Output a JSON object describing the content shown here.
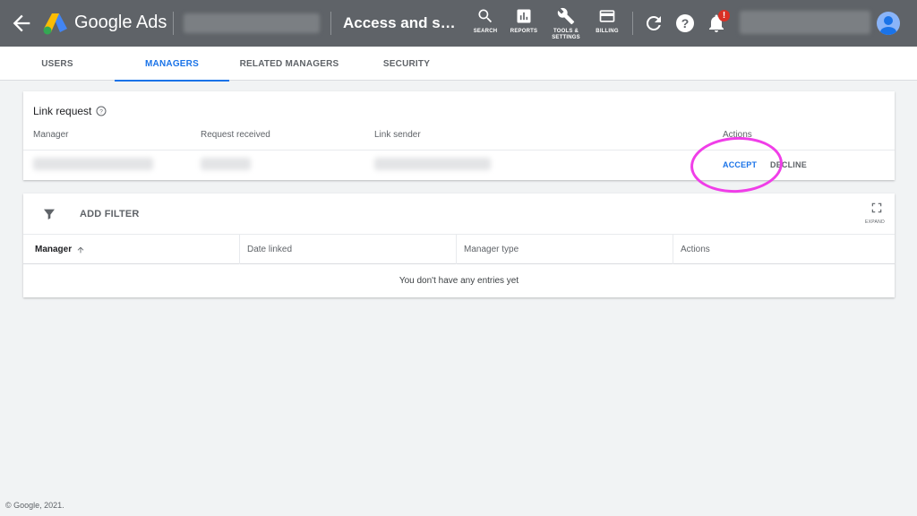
{
  "header": {
    "brand": "Google Ads",
    "page_title": "Access and s…",
    "toolbar": [
      {
        "label": "SEARCH",
        "icon": "search-icon"
      },
      {
        "label": "REPORTS",
        "icon": "reports-icon"
      },
      {
        "label": "TOOLS & SETTINGS",
        "icon": "wrench-icon"
      },
      {
        "label": "BILLING",
        "icon": "credit-card-icon"
      }
    ],
    "notification_badge": "!",
    "colors": {
      "bar": "#5f6368",
      "badge": "#d93025"
    }
  },
  "tabs": [
    {
      "label": "USERS",
      "active": false
    },
    {
      "label": "MANAGERS",
      "active": true
    },
    {
      "label": "RELATED MANAGERS",
      "active": false
    },
    {
      "label": "SECURITY",
      "active": false
    }
  ],
  "link_request": {
    "title": "Link request",
    "columns": [
      "Manager",
      "Request received",
      "Link sender",
      "Actions"
    ],
    "actions": {
      "accept": "ACCEPT",
      "decline": "DECLINE"
    }
  },
  "managers_table": {
    "add_filter": "ADD FILTER",
    "expand": "EXPAND",
    "columns": [
      "Manager",
      "Date linked",
      "Manager type",
      "Actions"
    ],
    "empty_message": "You don't have any entries yet"
  },
  "footer": "© Google, 2021.",
  "accent_color": "#1a73e8",
  "highlight_color": "#f03ee8"
}
